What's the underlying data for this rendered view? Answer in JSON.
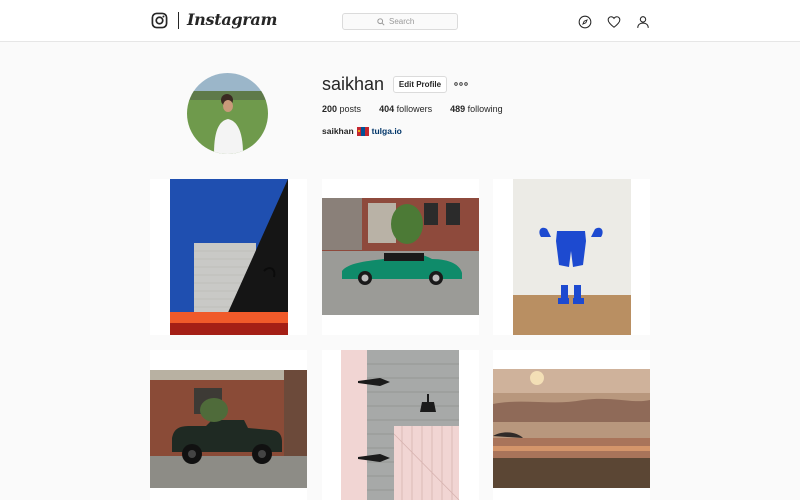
{
  "header": {
    "logo_text": "Instagram",
    "search_placeholder": "Search",
    "icons": [
      "instagram-glyph-icon",
      "search-icon",
      "compass-icon",
      "heart-icon",
      "person-icon"
    ]
  },
  "profile": {
    "username": "saikhan",
    "edit_button": "Edit Profile",
    "more_icon": "ellipsis-icon",
    "stats": {
      "posts_count": "200",
      "posts_label": "posts",
      "followers_count": "404",
      "followers_label": "followers",
      "following_count": "489",
      "following_label": "following"
    },
    "full_name": "saikhan",
    "flag_emoji_icon": "mongolia-flag-icon",
    "website": "tulga.io"
  },
  "posts": [
    {
      "id": "post-1",
      "subject": "blue-sky-building-corner"
    },
    {
      "id": "post-2",
      "subject": "green-vintage-convertible"
    },
    {
      "id": "post-3",
      "subject": "blue-sculpture-on-wall"
    },
    {
      "id": "post-4",
      "subject": "dark-green-vintage-truck"
    },
    {
      "id": "post-5",
      "subject": "pink-wooden-door-lamp"
    },
    {
      "id": "post-6",
      "subject": "sunset-over-water"
    }
  ],
  "colors": {
    "text": "#262626",
    "border": "#dbdbdb",
    "link": "#003569",
    "background": "#fafafa"
  }
}
